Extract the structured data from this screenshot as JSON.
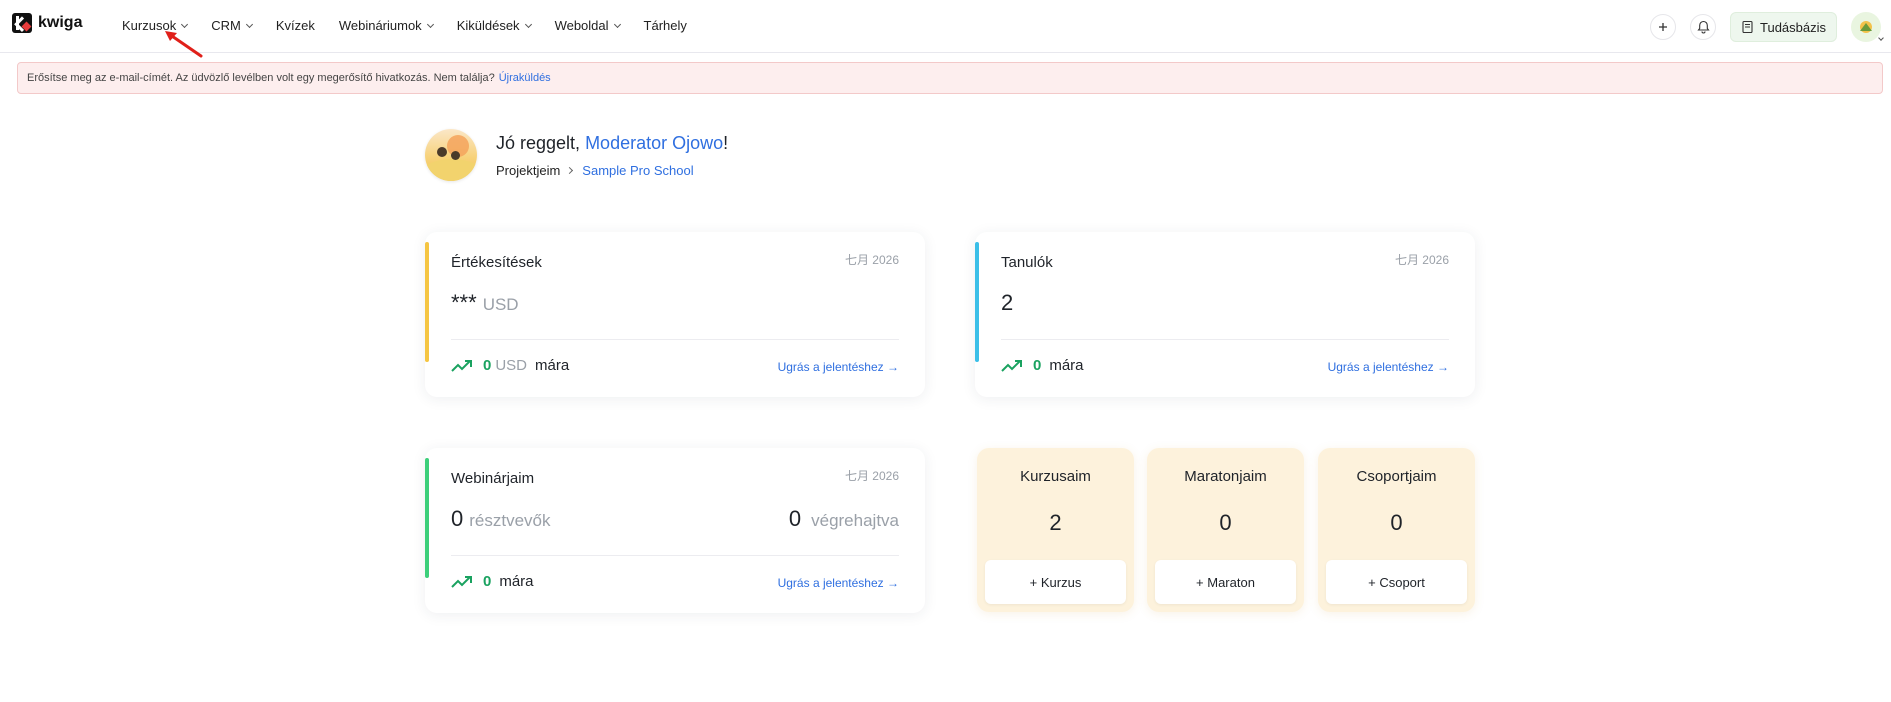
{
  "brand": {
    "name": "kwiga"
  },
  "nav": [
    {
      "label": "Kurzusok",
      "dropdown": true
    },
    {
      "label": "CRM",
      "dropdown": true
    },
    {
      "label": "Kvízek",
      "dropdown": false
    },
    {
      "label": "Webináriumok",
      "dropdown": true
    },
    {
      "label": "Kiküldések",
      "dropdown": true
    },
    {
      "label": "Weboldal",
      "dropdown": true
    },
    {
      "label": "Tárhely",
      "dropdown": false
    }
  ],
  "topRight": {
    "add_icon": "plus-icon",
    "bell_icon": "bell-icon",
    "knowledge_label": "Tudásbázis"
  },
  "alert": {
    "text": "Erősítse meg az e-mail-címét. Az üdvözlő levélben volt egy megerősítő hivatkozás. Nem találja?",
    "link": "Újraküldés"
  },
  "greeting": {
    "prefix": "Jó reggelt, ",
    "name": "Moderator Ojowo",
    "suffix": "!",
    "crumb_root": "Projektjeim",
    "crumb_current": "Sample Pro School"
  },
  "cards": {
    "sales": {
      "title": "Értékesítések",
      "date": "七月 2026",
      "value": "***",
      "unit": "USD",
      "today_value": "0",
      "today_unit": "USD",
      "today_label": "mára",
      "report": "Ugrás a jelentéshez →"
    },
    "students": {
      "title": "Tanulók",
      "date": "七月 2026",
      "value": "2",
      "today_value": "0",
      "today_label": "mára",
      "report": "Ugrás a jelentéshez →"
    },
    "webinars": {
      "title": "Webinárjaim",
      "date": "七月 2026",
      "participants_value": "0",
      "participants_label": "résztvevők",
      "done_value": "0",
      "done_label": "végrehajtva",
      "today_value": "0",
      "today_label": "mára",
      "report": "Ugrás a jelentéshez →"
    }
  },
  "tiles": [
    {
      "title": "Kurzusaim",
      "value": "2",
      "button": "+ Kurzus"
    },
    {
      "title": "Maratonjaim",
      "value": "0",
      "button": "+ Maraton"
    },
    {
      "title": "Csoportjaim",
      "value": "0",
      "button": "+ Csoport"
    }
  ],
  "colors": {
    "accent": "#2f6fe0",
    "sales_bar": "#f5c542",
    "students_bar": "#3bbfe8",
    "webinars_bar": "#3ccf7a",
    "positive": "#1aa260",
    "tile_bg": "#fdf2dc",
    "alert_bg": "#fdeeee"
  }
}
